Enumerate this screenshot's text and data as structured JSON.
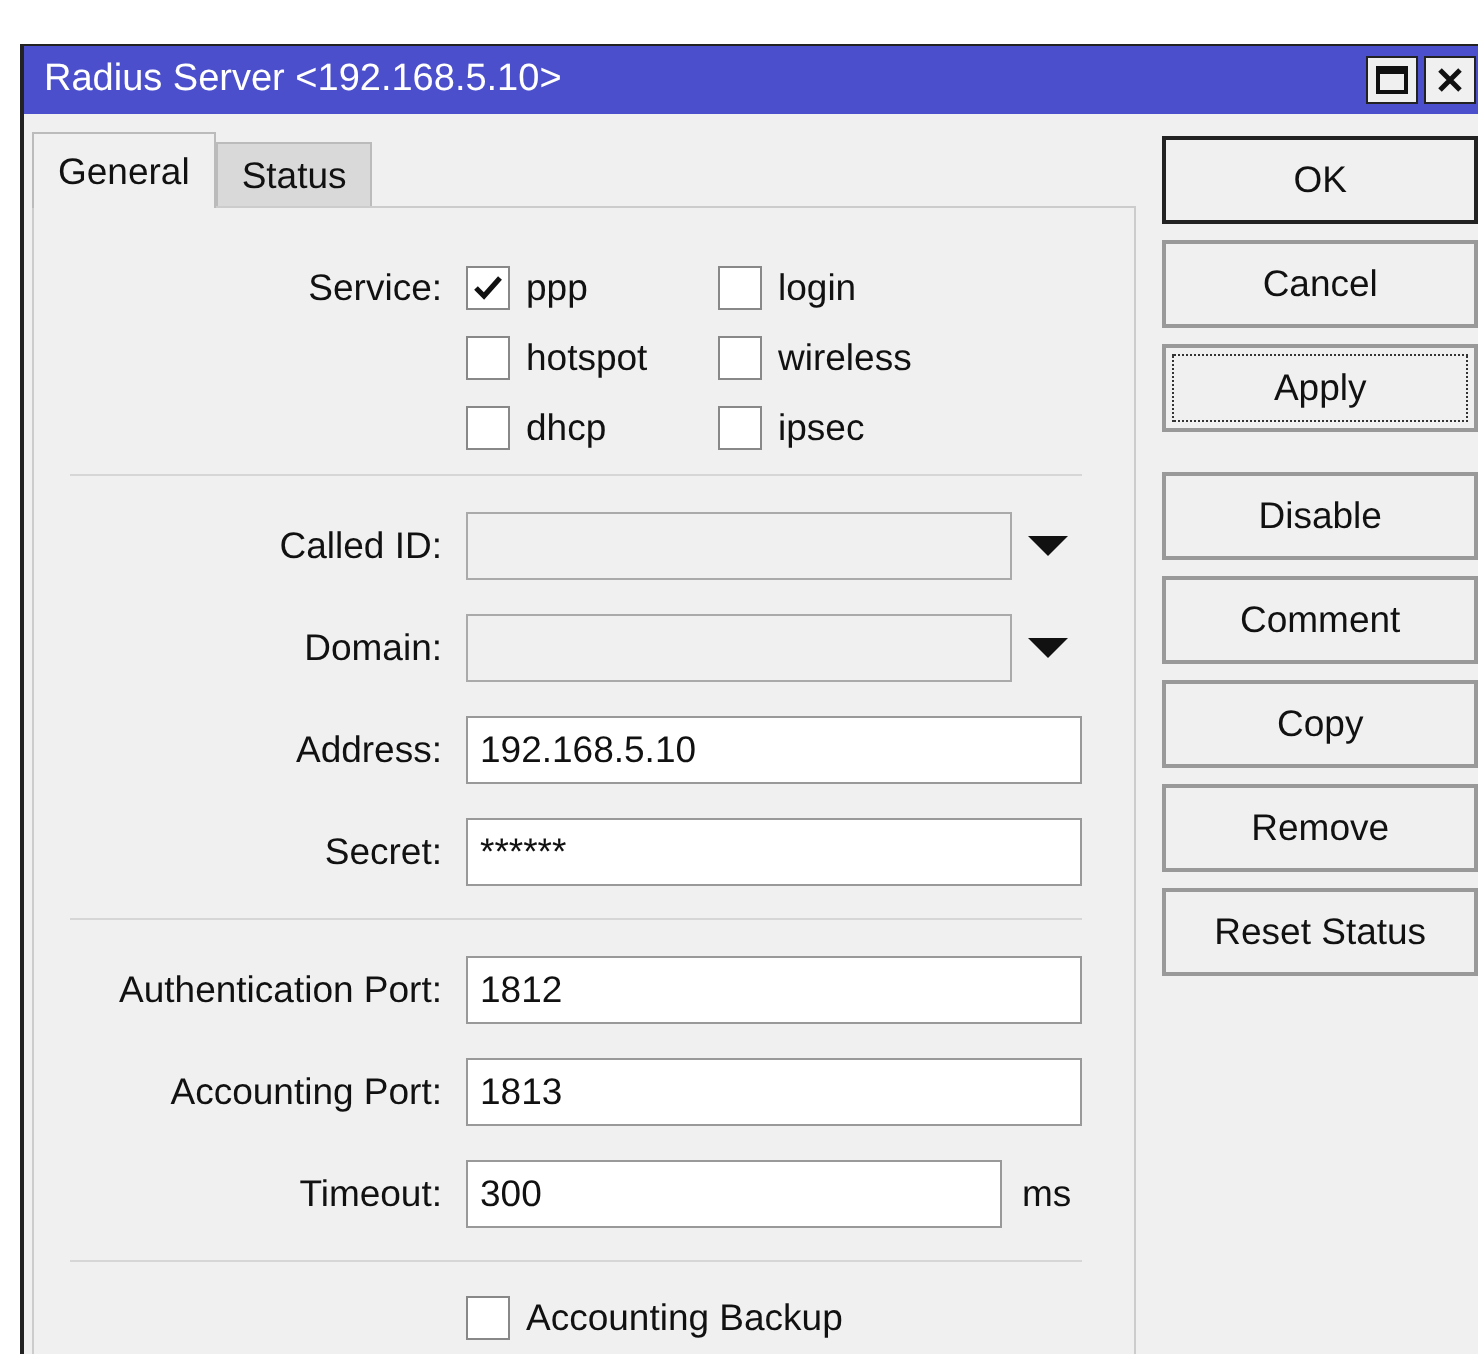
{
  "window": {
    "title": "Radius Server <192.168.5.10>"
  },
  "tabs": [
    {
      "label": "General",
      "selected": true
    },
    {
      "label": "Status",
      "selected": false
    }
  ],
  "sections": [
    {
      "kind": "checkgrid",
      "label": "Service:",
      "options": [
        {
          "label": "ppp",
          "checked": true
        },
        {
          "label": "login",
          "checked": false
        },
        {
          "label": "hotspot",
          "checked": false
        },
        {
          "label": "wireless",
          "checked": false
        },
        {
          "label": "dhcp",
          "checked": false
        },
        {
          "label": "ipsec",
          "checked": false
        }
      ]
    },
    {
      "kind": "fields",
      "fields": [
        {
          "kind": "combo",
          "label": "Called ID:"
        },
        {
          "kind": "combo",
          "label": "Domain:"
        },
        {
          "kind": "text",
          "label": "Address:",
          "value": "192.168.5.10"
        },
        {
          "kind": "text",
          "label": "Secret:",
          "value": "******"
        }
      ]
    },
    {
      "kind": "fields",
      "fields": [
        {
          "kind": "text",
          "label": "Authentication Port:",
          "value": "1812"
        },
        {
          "kind": "text",
          "label": "Accounting Port:",
          "value": "1813"
        },
        {
          "kind": "unit",
          "label": "Timeout:",
          "value": "300",
          "unit": "ms"
        }
      ]
    },
    {
      "kind": "checkbox",
      "option": {
        "label": "Accounting Backup",
        "checked": false
      }
    }
  ],
  "button_groups": [
    {
      "buttons": [
        {
          "label": "OK",
          "default": true,
          "focused": false
        },
        {
          "label": "Cancel",
          "default": false,
          "focused": false
        },
        {
          "label": "Apply",
          "default": false,
          "focused": true
        }
      ]
    },
    {
      "buttons": [
        {
          "label": "Disable",
          "default": false,
          "focused": false
        },
        {
          "label": "Comment",
          "default": false,
          "focused": false
        },
        {
          "label": "Copy",
          "default": false,
          "focused": false
        },
        {
          "label": "Remove",
          "default": false,
          "focused": false
        },
        {
          "label": "Reset Status",
          "default": false,
          "focused": false
        }
      ]
    }
  ]
}
